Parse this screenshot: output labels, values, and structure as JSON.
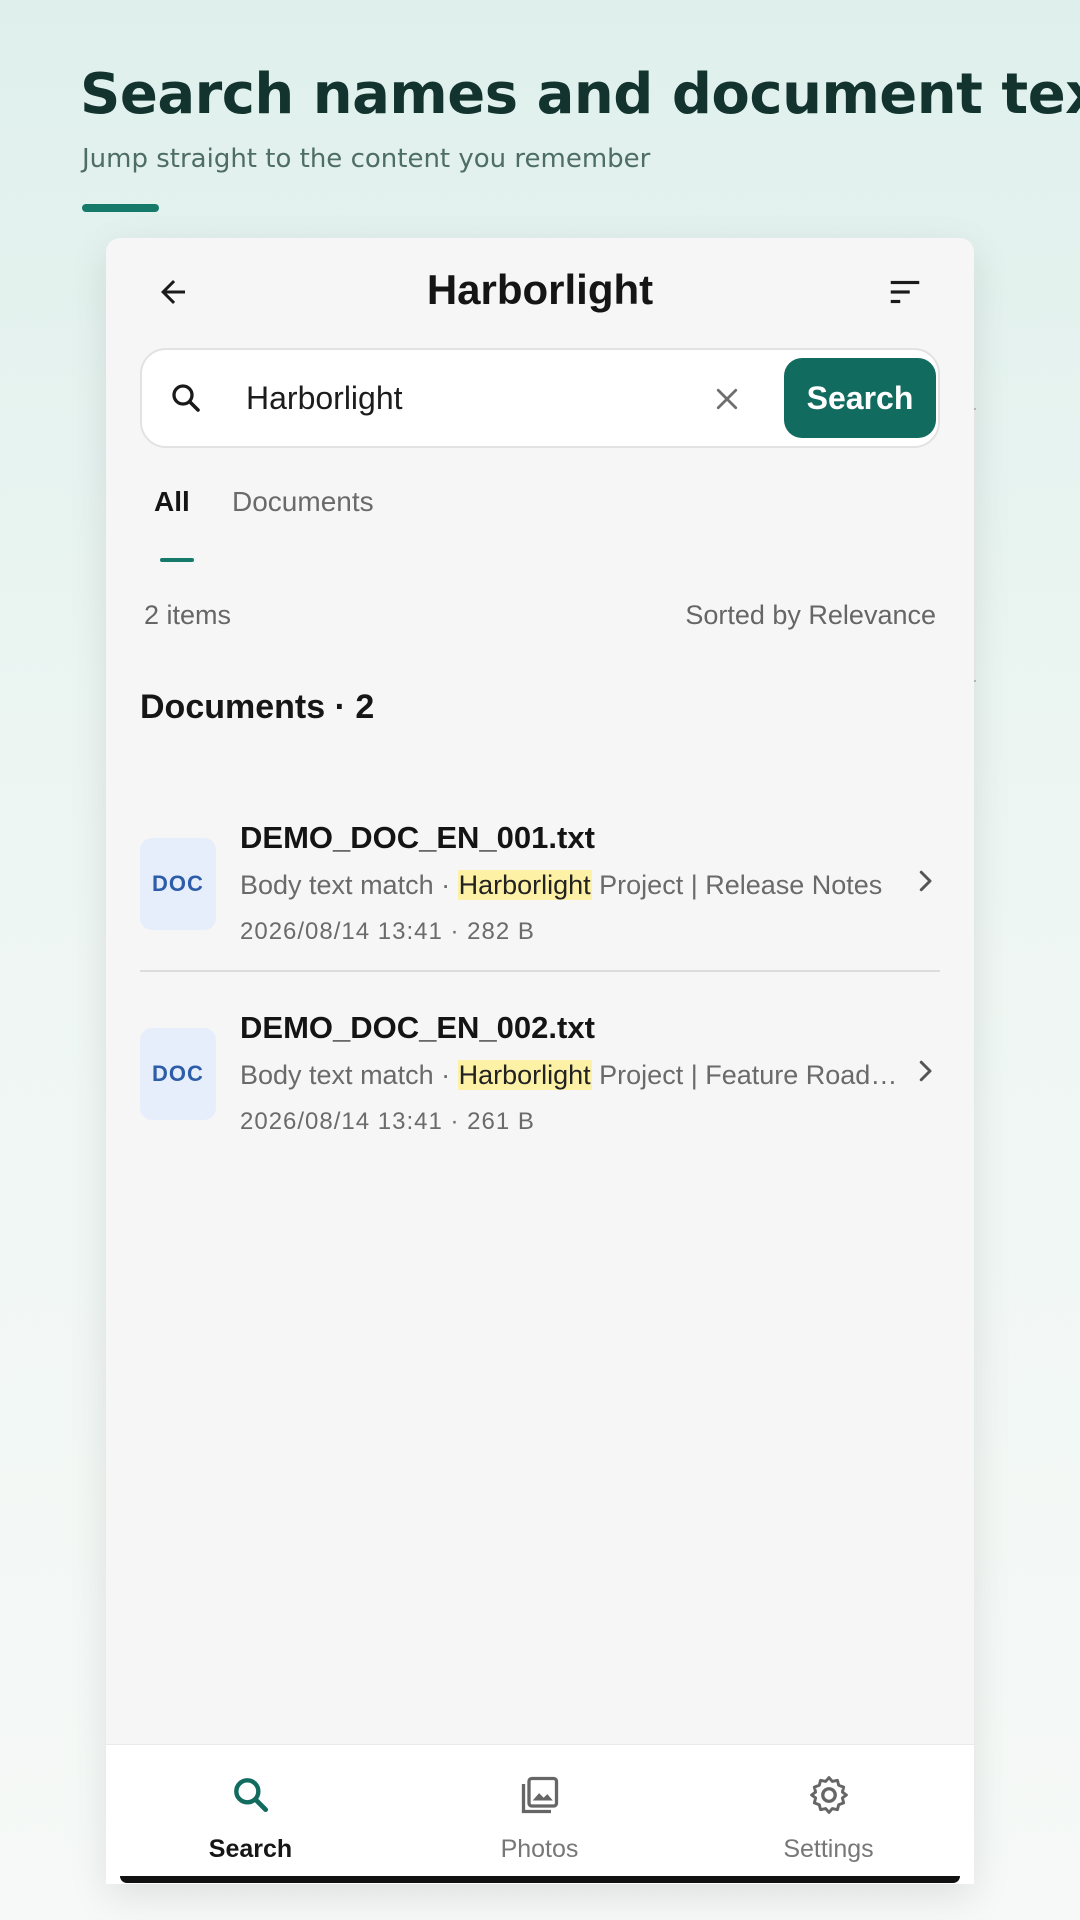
{
  "hero": {
    "title": "Search names and document text",
    "subtitle": "Jump straight to the content you remember"
  },
  "appbar": {
    "title": "Harborlight",
    "icons": [
      "arrow-back-icon",
      "sort-icon"
    ]
  },
  "search": {
    "value": "Harborlight",
    "button_label": "Search"
  },
  "tabs": [
    {
      "label": "All",
      "active": true
    },
    {
      "label": "Documents",
      "active": false
    }
  ],
  "results_meta": {
    "count": "2 items",
    "sort": "Sorted by Relevance"
  },
  "section": {
    "title": "Documents · 2"
  },
  "documents": [
    {
      "badge": "DOC",
      "name": "DEMO_DOC_EN_001.txt",
      "snippet_prefix": "Body text match · ",
      "snippet_highlight": "Harborlight",
      "snippet_suffix": " Project | Release Notes",
      "date": "2026/08/14 13:41",
      "size": "282 B"
    },
    {
      "badge": "DOC",
      "name": "DEMO_DOC_EN_002.txt",
      "snippet_prefix": "Body text match · ",
      "snippet_highlight": "Harborlight",
      "snippet_suffix": " Project | Feature Roadmap",
      "date": "2026/08/14 13:41",
      "size": "261 B"
    }
  ],
  "bottom_nav": [
    {
      "label": "Search",
      "icon": "search-icon",
      "active": true
    },
    {
      "label": "Photos",
      "icon": "photos-icon",
      "active": false
    },
    {
      "label": "Settings",
      "icon": "gear-icon",
      "active": false
    }
  ],
  "colors": {
    "accent": "#126b5f",
    "highlight": "#fdf1a6",
    "doc_badge_bg": "#e6eefc",
    "doc_badge_text": "#2d5da8"
  }
}
